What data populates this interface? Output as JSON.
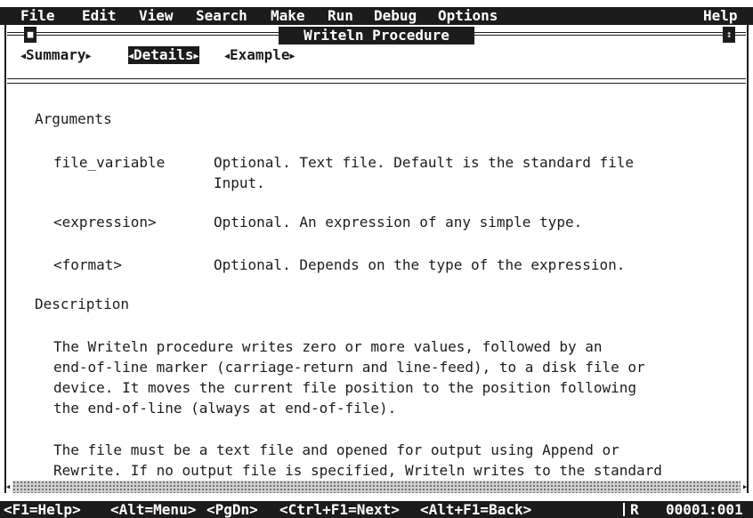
{
  "menu": {
    "file": "File",
    "edit": "Edit",
    "view": "View",
    "search": "Search",
    "make": "Make",
    "run": "Run",
    "debug": "Debug",
    "options": "Options",
    "help": "Help"
  },
  "window": {
    "title": "Writeln Procedure",
    "close_icon": "close-box",
    "zoom_icon": "zoom-box"
  },
  "tabs": [
    {
      "label": "Summary",
      "active": false
    },
    {
      "label": "Details",
      "active": true
    },
    {
      "label": "Example",
      "active": false
    }
  ],
  "content": {
    "arguments_heading": "Arguments",
    "args": [
      {
        "name": "file_variable",
        "desc_lines": [
          "Optional. Text file. Default is the standard file",
          "Input."
        ]
      },
      {
        "name": "<expression>",
        "desc_lines": [
          "Optional. An expression of any simple type."
        ]
      },
      {
        "name": "<format>",
        "desc_lines": [
          "Optional. Depends on the type of the expression."
        ]
      }
    ],
    "description_heading": "Description",
    "paragraph1": [
      "The Writeln procedure writes zero or more values, followed by an",
      "end-of-line marker (carriage-return and line-feed), to a disk file or",
      "device. It moves the current file position to the position following",
      "the end-of-line (always at end-of-file)."
    ],
    "paragraph2": [
      "The file must be a text file and opened for output using Append or",
      "Rewrite. If no output file is specified, Writeln writes to the standard"
    ]
  },
  "status": {
    "help": "<F1=Help>",
    "menu": "<Alt=Menu>",
    "pgdn": "<PgDn>",
    "next": "<Ctrl+F1=Next>",
    "back": "<Alt+F1=Back>",
    "mode": "R",
    "position": "00001:001"
  },
  "colors": {
    "foreground": "#1c1c1c",
    "background": "#ffffff"
  }
}
